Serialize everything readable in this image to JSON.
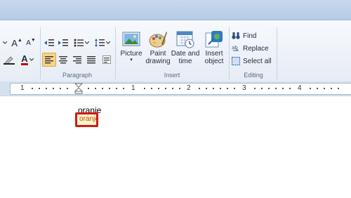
{
  "ribbon": {
    "paragraph": {
      "label": "Paragraph"
    },
    "insert": {
      "label": "Insert",
      "picture_label": "Picture",
      "paint_label": "Paint drawing",
      "datetime_label": "Date and time",
      "object_label": "Insert object"
    },
    "editing": {
      "label": "Editing",
      "find_label": "Find",
      "replace_label": "Replace",
      "select_all_label": "Select all"
    },
    "font": {
      "grow_label": "A",
      "shrink_label": "A",
      "color_label": "A"
    }
  },
  "ruler": {
    "labels": [
      "1",
      "1",
      "2",
      "3",
      "4"
    ]
  },
  "document": {
    "line1": "oranje",
    "autocomplete": "oranje"
  },
  "colors": {
    "highlight_border": "#d01a1a",
    "selected_button": "#f7d48a"
  }
}
